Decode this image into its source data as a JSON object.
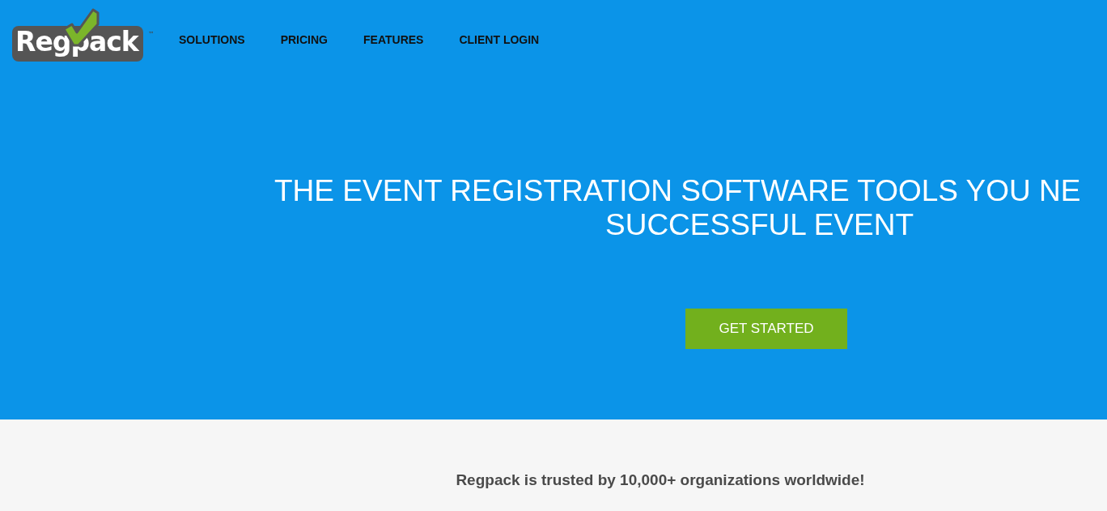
{
  "header": {
    "logo": {
      "name": "Regpack",
      "trademark": "™"
    },
    "nav": [
      {
        "label": "SOLUTIONS"
      },
      {
        "label": "PRICING"
      },
      {
        "label": "FEATURES"
      },
      {
        "label": "CLIENT LOGIN"
      }
    ]
  },
  "hero": {
    "headline": [
      "THE EVENT REGISTRATION SOFTWARE TOOLS YOU NE",
      "SUCCESSFUL EVENT"
    ],
    "cta": "GET STARTED"
  },
  "trust": {
    "text": "Regpack is trusted by 10,000+ organizations worldwide!"
  }
}
